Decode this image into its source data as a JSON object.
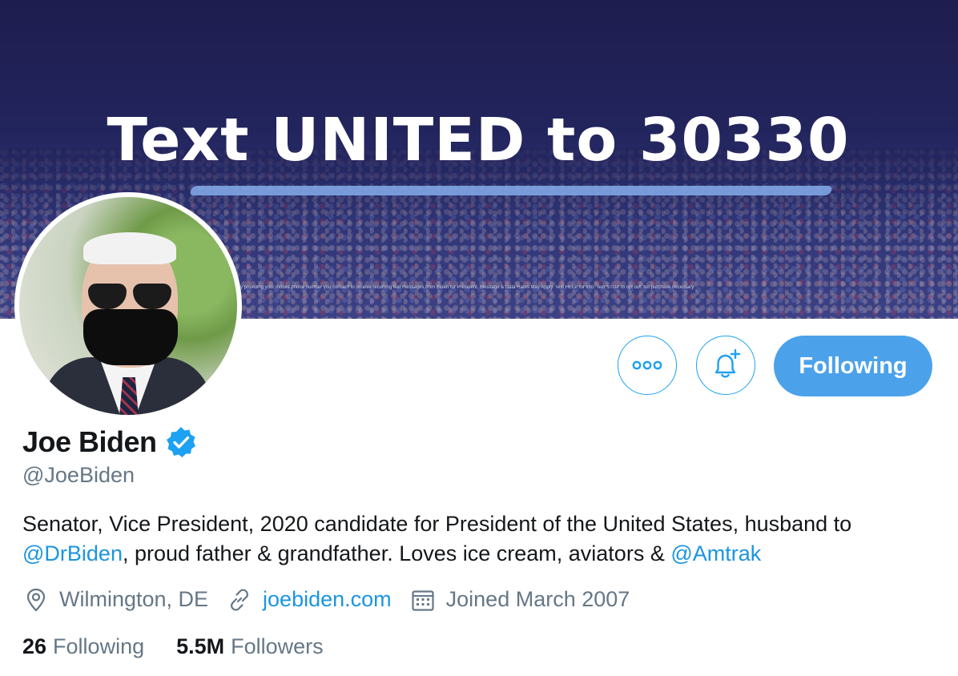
{
  "banner": {
    "headline": "Text UNITED to 30330",
    "fineprint": "By providing your mobile phone number you consent to receive recurring text messages from Biden for President. Message & Data Rates May Apply. Text HELP for info. Text STOP to opt out. No purchase necessary."
  },
  "profile": {
    "display_name": "Joe Biden",
    "handle": "@JoeBiden",
    "verified": true,
    "bio_part1": "Senator, Vice President, 2020 candidate for President of the United States, husband to ",
    "bio_mention1": "@DrBiden",
    "bio_part2": ", proud father & grandfather. Loves ice cream, aviators & ",
    "bio_mention2": "@Amtrak",
    "location": "Wilmington, DE",
    "website": "joebiden.com",
    "joined": "Joined March 2007"
  },
  "actions": {
    "more_icon": "more-dots-icon",
    "notify_icon": "bell-plus-icon",
    "follow_label": "Following"
  },
  "stats": {
    "following_count": "26",
    "following_label": "Following",
    "followers_count": "5.5M",
    "followers_label": "Followers"
  },
  "colors": {
    "accent": "#1da1f2",
    "follow_button": "#4ca2ea",
    "link": "#1b95e0",
    "secondary_text": "#657786",
    "banner_bg": "#22245c"
  }
}
